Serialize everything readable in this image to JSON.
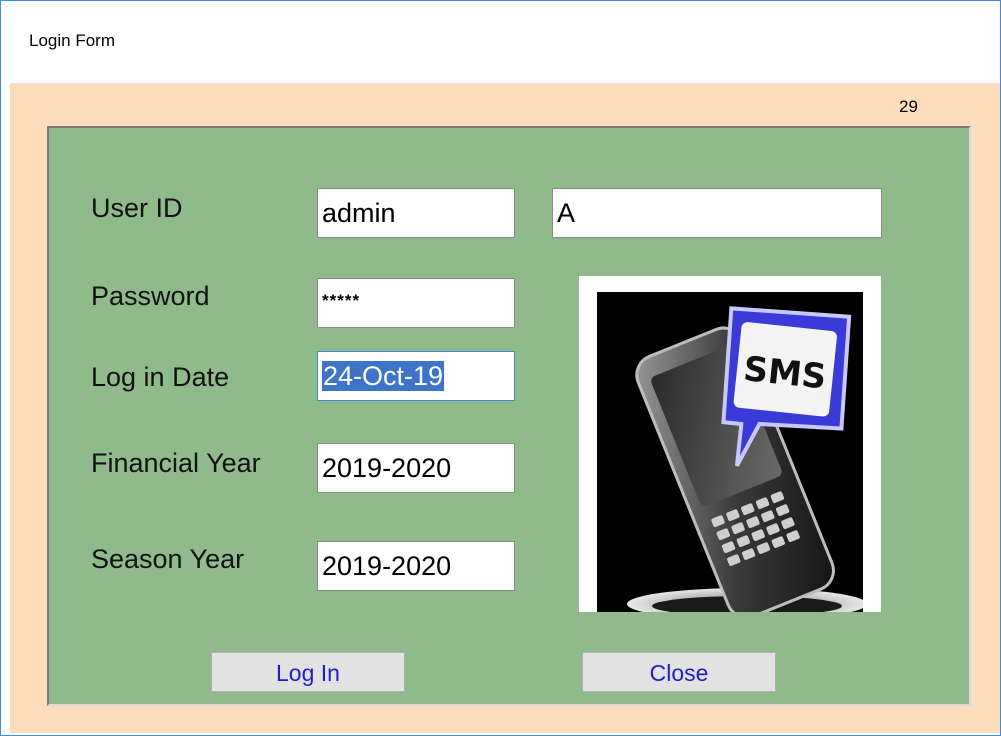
{
  "window": {
    "title": "Login Form"
  },
  "counter": "29",
  "form": {
    "user_id": {
      "label": "User ID",
      "value": "admin",
      "extra_value": "A"
    },
    "password": {
      "label": "Password",
      "value": "*****"
    },
    "login_date": {
      "label": "Log in Date",
      "value": "24-Oct-19"
    },
    "financial_year": {
      "label": "Financial Year",
      "value": "2019-2020"
    },
    "season_year": {
      "label": "Season Year",
      "value": "2019-2020"
    }
  },
  "image": {
    "icon": "sms-phone-image",
    "text": "SMS"
  },
  "buttons": {
    "login": "Log In",
    "close": "Close"
  },
  "colors": {
    "panel": "#8fbb8a",
    "client": "#ffdcbc",
    "button_text": "#1e1ec8",
    "selection": "#3d73c8"
  }
}
